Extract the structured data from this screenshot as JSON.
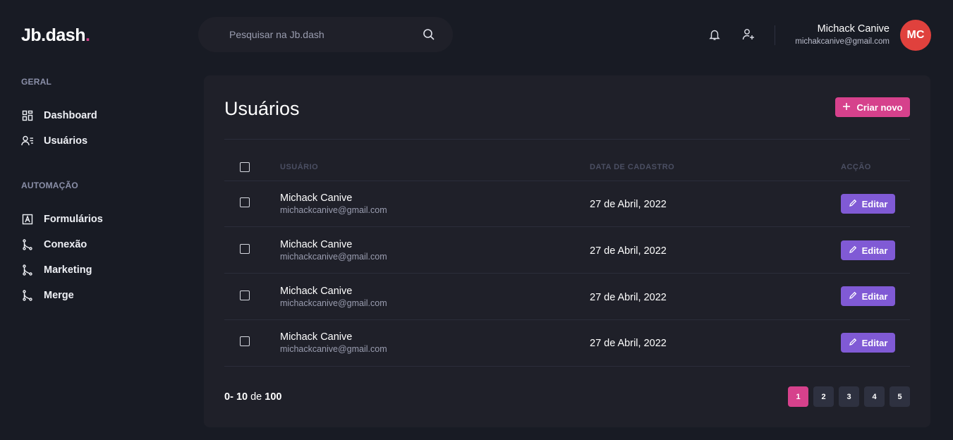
{
  "brand": {
    "name": "Jb.dash",
    "dot": ".",
    "dot_color": "#d6418c"
  },
  "sidebar": {
    "sections": [
      {
        "title": "GERAL",
        "items": [
          {
            "label": "Dashboard",
            "icon": "dashboard-grid-icon"
          },
          {
            "label": "Usuários",
            "icon": "users-list-icon"
          }
        ]
      },
      {
        "title": "AUTOMAÇÃO",
        "items": [
          {
            "label": "Formulários",
            "icon": "form-icon"
          },
          {
            "label": "Conexão",
            "icon": "git-branch-icon"
          },
          {
            "label": "Marketing",
            "icon": "git-branch-icon"
          },
          {
            "label": "Merge",
            "icon": "git-branch-icon"
          }
        ]
      }
    ]
  },
  "search": {
    "placeholder": "Pesquisar na Jb.dash",
    "value": "",
    "icon": "search-icon"
  },
  "header": {
    "icons": [
      "bell-icon",
      "user-add-icon"
    ],
    "user": {
      "name": "Michack Canive",
      "email": "michakcanive@gmail.com",
      "initials": "MC",
      "avatar_color": "#e0413d"
    }
  },
  "main": {
    "title": "Usuários",
    "create_label": "Criar novo",
    "columns": {
      "user": "USUÁRIO",
      "date": "DATA DE CADASTRO",
      "action": "ACÇÃO"
    },
    "rows": [
      {
        "name": "Michack Canive",
        "email": "michackcanive@gmail.com",
        "date": "27 de Abril, 2022",
        "action": "Editar"
      },
      {
        "name": "Michack Canive",
        "email": "michackcanive@gmail.com",
        "date": "27 de Abril, 2022",
        "action": "Editar"
      },
      {
        "name": "Michack Canive",
        "email": "michackcanive@gmail.com",
        "date": "27 de Abril, 2022",
        "action": "Editar"
      },
      {
        "name": "Michack Canive",
        "email": "michackcanive@gmail.com",
        "date": "27 de Abril, 2022",
        "action": "Editar"
      }
    ],
    "pagination": {
      "from": "0",
      "sep": "- ",
      "to": "10",
      "of_label": "de",
      "total": "100",
      "pages": [
        "1",
        "2",
        "3",
        "4",
        "5"
      ],
      "current": "1"
    }
  },
  "colors": {
    "background": "#181b24",
    "card": "#1f2029",
    "accent_pink": "#d6418c",
    "accent_purple": "#805ad5"
  }
}
